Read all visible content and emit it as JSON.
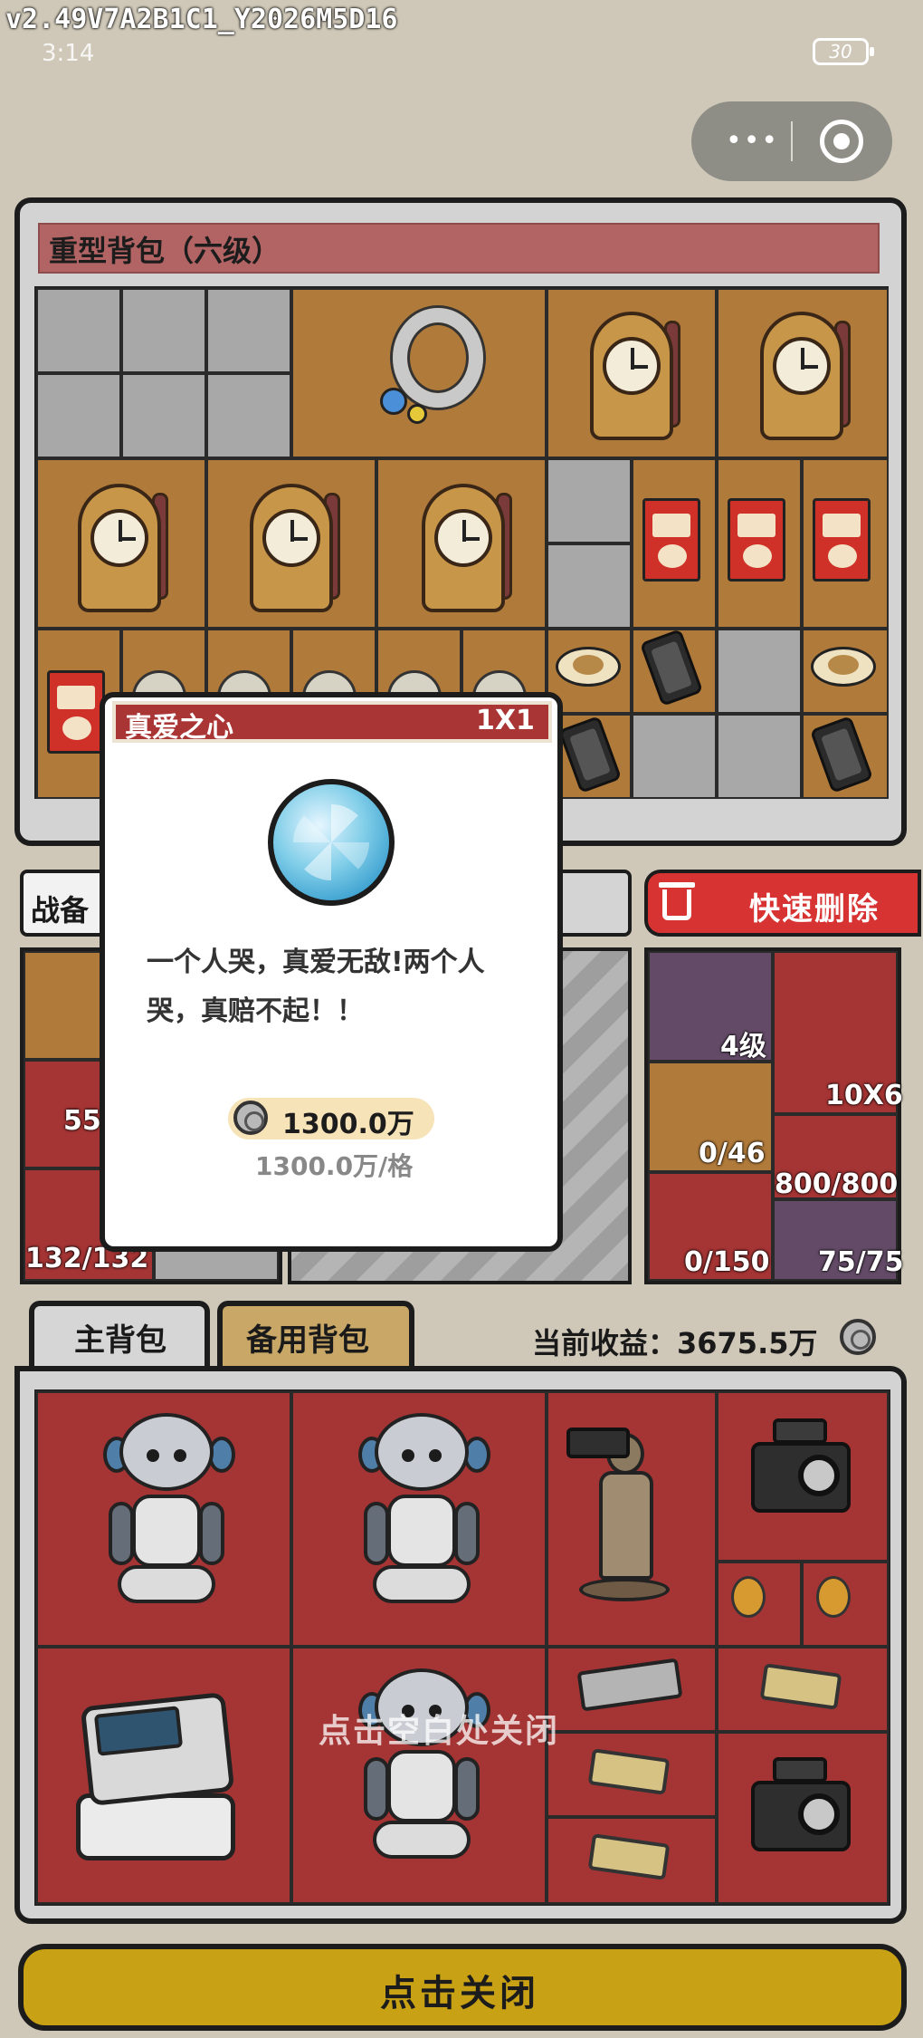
{
  "status_bar": {
    "version": "v2.49V7A2B1C1_Y2026M5D16",
    "time": "3:14",
    "battery": "30"
  },
  "capsule": {
    "more_icon": "more-dots-icon",
    "close_icon": "target-close-icon"
  },
  "heavy_backpack": {
    "title": "重型背包（六级）",
    "items": [
      "necklace",
      "clock",
      "clock",
      "clock",
      "clock",
      "clock",
      "coffee-box",
      "coffee-box",
      "coffee-box",
      "coffee-box",
      "coffee-cup",
      "phone",
      "coffee-cup",
      "phone",
      "phone",
      "heart-item",
      "heart-item",
      "heart-item",
      "heart-item",
      "heart-item"
    ]
  },
  "equipment": {
    "tab_label": "战备",
    "left_values": [
      "55",
      "132/132"
    ],
    "fast_delete_label": "快速删除",
    "right_values": [
      "4级",
      "10X6",
      "0/46",
      "800/800",
      "0/150",
      "75/75"
    ]
  },
  "tabs": {
    "main": "主背包",
    "spare": "备用背包"
  },
  "earnings": {
    "label": "当前收益：3675.5万"
  },
  "main_backpack": {
    "items": [
      "robot",
      "robot",
      "terracotta-warrior",
      "camera",
      "watch",
      "watch",
      "ecg-monitor",
      "robot",
      "gpu",
      "gold-bar",
      "gold-bar",
      "gold-bar",
      "camera"
    ],
    "close_hint": "点击空白处关闭"
  },
  "dialog": {
    "title": "真爱之心",
    "size": "1X1",
    "description": "一个人哭，真爱无敌!两个人哭，真赔不起！！",
    "price": "1300.0万",
    "price_per_cell": "1300.0万/格"
  },
  "close_button": {
    "label": "点击关闭"
  },
  "colors": {
    "background": "#cfc8b8",
    "brown_cell": "#b07a3a",
    "red_cell": "#a53434",
    "accent_red": "#d83333",
    "close_yellow": "#c9a114"
  }
}
